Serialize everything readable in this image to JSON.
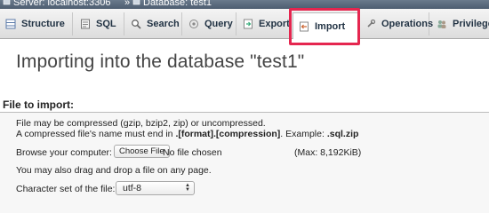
{
  "breadcrumb": {
    "server": "Server: localhost:3306",
    "separator": "»",
    "database": "Database: test1"
  },
  "tabs": [
    {
      "label": "Structure",
      "icon": "structure-icon"
    },
    {
      "label": "SQL",
      "icon": "sql-icon"
    },
    {
      "label": "Search",
      "icon": "search-icon"
    },
    {
      "label": "Query",
      "icon": "query-icon"
    },
    {
      "label": "Export",
      "icon": "export-icon"
    },
    {
      "label": "Import",
      "icon": "import-icon",
      "active": true
    },
    {
      "label": "Operations",
      "icon": "operations-icon"
    },
    {
      "label": "Privileges",
      "icon": "privileges-icon"
    }
  ],
  "main": {
    "title": "Importing into the database \"test1\"",
    "section_title": "File to import:",
    "compress_line1": "File may be compressed (gzip, bzip2, zip) or uncompressed.",
    "compress_line2_prefix": "A compressed file's name must end in ",
    "compress_line2_format": ".[format].[compression]",
    "compress_line2_mid": ". Example: ",
    "compress_line2_example": ".sql.zip",
    "browse_label": "Browse your computer:",
    "choose_file_label": "Choose File",
    "no_file_text": "No file chosen",
    "max_size": "(Max: 8,192KiB)",
    "drag_text": "You may also drag and drop a file on any page.",
    "charset_label": "Character set of the file:",
    "charset_value": "utf-8"
  },
  "colors": {
    "highlight": "#e5264f",
    "breadcrumb_bg": "#5a6a7d"
  }
}
